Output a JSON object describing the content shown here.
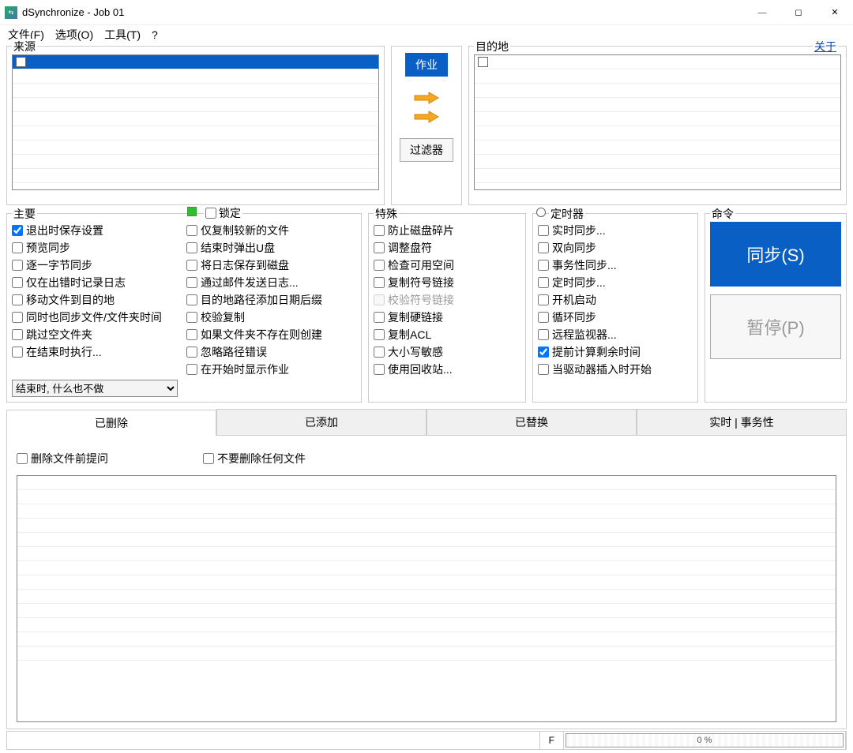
{
  "window": {
    "title": "dSynchronize - Job 01"
  },
  "menu": {
    "file": "文件(F)",
    "options": "选项(O)",
    "tools": "工具(T)",
    "help": "?"
  },
  "panels": {
    "source_label": "来源",
    "dest_label": "目的地",
    "about": "关于",
    "job_btn": "作业",
    "filter_btn": "过滤器"
  },
  "main": {
    "title": "主要",
    "lock": "锁定",
    "left": [
      "退出时保存设置",
      "预览同步",
      "逐一字节同步",
      "仅在出错时记录日志",
      "移动文件到目的地",
      "同时也同步文件/文件夹时间",
      "跳过空文件夹",
      "在结束时执行..."
    ],
    "left_checked": [
      true,
      false,
      false,
      false,
      false,
      false,
      false,
      false
    ],
    "right": [
      "仅复制较新的文件",
      "结束时弹出U盘",
      "将日志保存到磁盘",
      "通过邮件发送日志...",
      "目的地路径添加日期后缀",
      "校验复制",
      "如果文件夹不存在则创建",
      "忽略路径错误",
      "在开始时显示作业"
    ],
    "end_combo": "结束时, 什么也不做"
  },
  "special": {
    "title": "特殊",
    "items": [
      "防止磁盘碎片",
      "调整盘符",
      "检查可用空间",
      "复制符号链接",
      "校验符号链接",
      "复制硬链接",
      "复制ACL",
      "大小写敏感",
      "使用回收站..."
    ],
    "disabled_idx": 4
  },
  "timer": {
    "title": "定时器",
    "items": [
      "实时同步...",
      "双向同步",
      "事务性同步...",
      "定时同步...",
      "开机启动",
      "循环同步",
      "远程监视器...",
      "提前计算剩余时间",
      "当驱动器插入时开始"
    ],
    "checked_idx": 7
  },
  "cmd": {
    "title": "命令",
    "sync": "同步(S)",
    "pause": "暂停(P)"
  },
  "tabs": {
    "deleted": "已删除",
    "added": "已添加",
    "replaced": "已替换",
    "rt": "实时 | 事务性",
    "ask_before_delete": "删除文件前提问",
    "no_delete": "不要删除任何文件"
  },
  "status": {
    "f": "F",
    "pct": "0 %"
  }
}
